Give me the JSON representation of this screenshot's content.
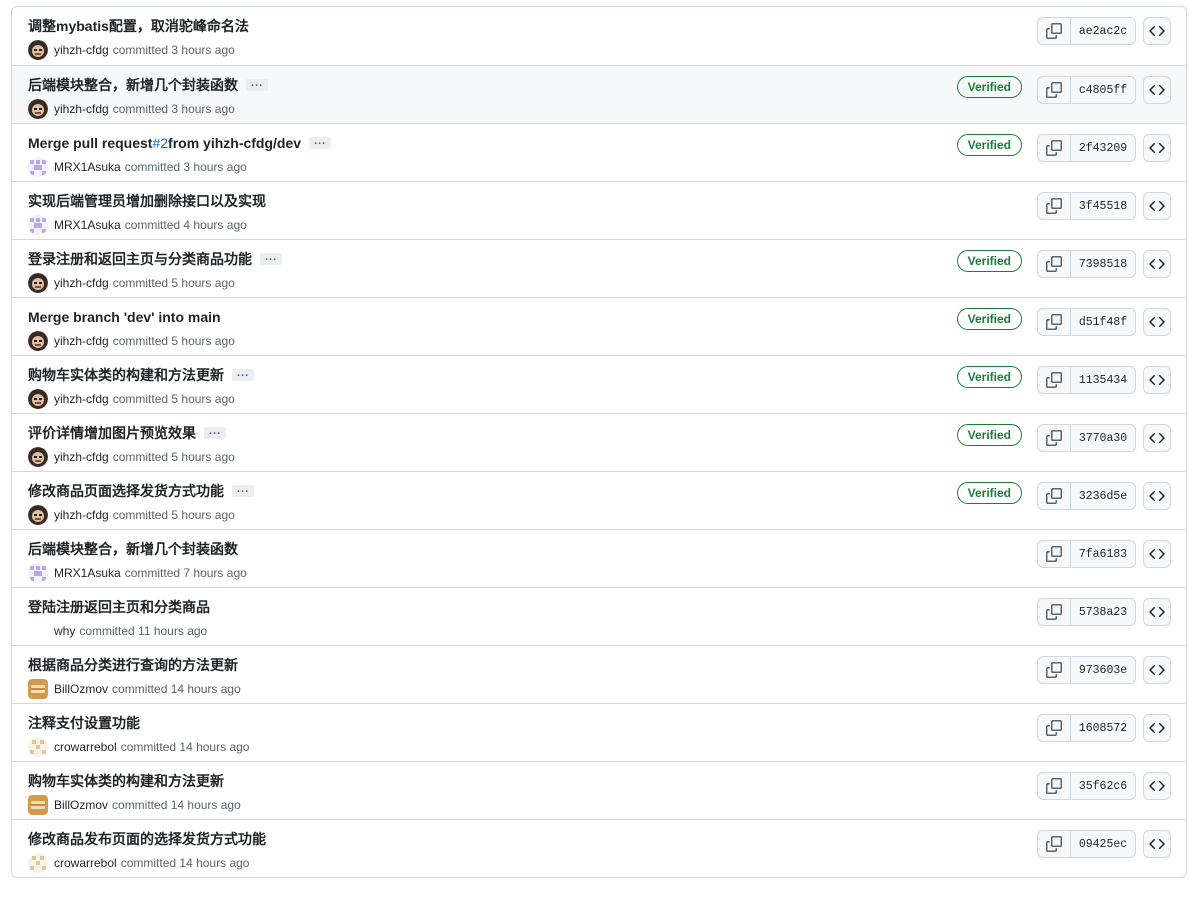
{
  "commits": [
    {
      "title": "调整mybatis配置，取消驼峰命名法",
      "link": "",
      "title_after": "",
      "ellipsis": false,
      "author": "yihzh-cfdg",
      "action": "committed",
      "time": "3 hours ago",
      "verified": "",
      "sha": "ae2ac2c",
      "avatar": "dark"
    },
    {
      "title": "后端模块整合，新增几个封装函数",
      "link": "",
      "title_after": "",
      "ellipsis": true,
      "author": "yihzh-cfdg",
      "action": "committed",
      "time": "3 hours ago",
      "verified": "Verified",
      "sha": "c4805ff",
      "avatar": "dark",
      "hover": true
    },
    {
      "title": "Merge pull request ",
      "link": "#2",
      "title_after": " from yihzh-cfdg/dev",
      "ellipsis": true,
      "author": "MRX1Asuka",
      "action": "committed",
      "time": "3 hours ago",
      "verified": "Verified",
      "sha": "2f43209",
      "avatar": "purple"
    },
    {
      "title": "实现后端管理员增加删除接口以及实现",
      "link": "",
      "title_after": "",
      "ellipsis": false,
      "author": "MRX1Asuka",
      "action": "committed",
      "time": "4 hours ago",
      "verified": "",
      "sha": "3f45518",
      "avatar": "purple"
    },
    {
      "title": "登录注册和返回主页与分类商品功能",
      "link": "",
      "title_after": "",
      "ellipsis": true,
      "author": "yihzh-cfdg",
      "action": "committed",
      "time": "5 hours ago",
      "verified": "Verified",
      "sha": "7398518",
      "avatar": "dark"
    },
    {
      "title": "Merge branch 'dev' into main",
      "link": "",
      "title_after": "",
      "ellipsis": false,
      "author": "yihzh-cfdg",
      "action": "committed",
      "time": "5 hours ago",
      "verified": "Verified",
      "sha": "d51f48f",
      "avatar": "dark"
    },
    {
      "title": "购物车实体类的构建和方法更新",
      "link": "",
      "title_after": "",
      "ellipsis": true,
      "author": "yihzh-cfdg",
      "action": "committed",
      "time": "5 hours ago",
      "verified": "Verified",
      "sha": "1135434",
      "avatar": "dark"
    },
    {
      "title": "评价详情增加图片预览效果",
      "link": "",
      "title_after": "",
      "ellipsis": true,
      "author": "yihzh-cfdg",
      "action": "committed",
      "time": "5 hours ago",
      "verified": "Verified",
      "sha": "3770a30",
      "avatar": "dark"
    },
    {
      "title": "修改商品页面选择发货方式功能",
      "link": "",
      "title_after": "",
      "ellipsis": true,
      "author": "yihzh-cfdg",
      "action": "committed",
      "time": "5 hours ago",
      "verified": "Verified",
      "sha": "3236d5e",
      "avatar": "dark"
    },
    {
      "title": "后端模块整合，新增几个封装函数",
      "link": "",
      "title_after": "",
      "ellipsis": false,
      "author": "MRX1Asuka",
      "action": "committed",
      "time": "7 hours ago",
      "verified": "",
      "sha": "7fa6183",
      "avatar": "purple"
    },
    {
      "title": "登陆注册返回主页和分类商品",
      "link": "",
      "title_after": "",
      "ellipsis": false,
      "author": "why",
      "action": "committed",
      "time": "11 hours ago",
      "verified": "",
      "sha": "5738a23",
      "avatar": "none"
    },
    {
      "title": "根据商品分类进行查询的方法更新",
      "link": "",
      "title_after": "",
      "ellipsis": false,
      "author": "BillOzmov",
      "action": "committed",
      "time": "14 hours ago",
      "verified": "",
      "sha": "973603e",
      "avatar": "orange"
    },
    {
      "title": "注释支付设置功能",
      "link": "",
      "title_after": "",
      "ellipsis": false,
      "author": "crowarrebol",
      "action": "committed",
      "time": "14 hours ago",
      "verified": "",
      "sha": "1608572",
      "avatar": "beige"
    },
    {
      "title": "购物车实体类的构建和方法更新",
      "link": "",
      "title_after": "",
      "ellipsis": false,
      "author": "BillOzmov",
      "action": "committed",
      "time": "14 hours ago",
      "verified": "",
      "sha": "35f62c6",
      "avatar": "orange"
    },
    {
      "title": "修改商品发布页面的选择发货方式功能",
      "link": "",
      "title_after": "",
      "ellipsis": false,
      "author": "crowarrebol",
      "action": "committed",
      "time": "14 hours ago",
      "verified": "",
      "sha": "09425ec",
      "avatar": "beige"
    }
  ],
  "icons": {
    "copy": "copy-icon",
    "browse": "code-icon",
    "ellipsis": "ellipsis-icon"
  },
  "colors": {
    "verified": "#1a7f37",
    "link": "#0969da",
    "border": "#d0d7de",
    "muted": "#59636e"
  }
}
